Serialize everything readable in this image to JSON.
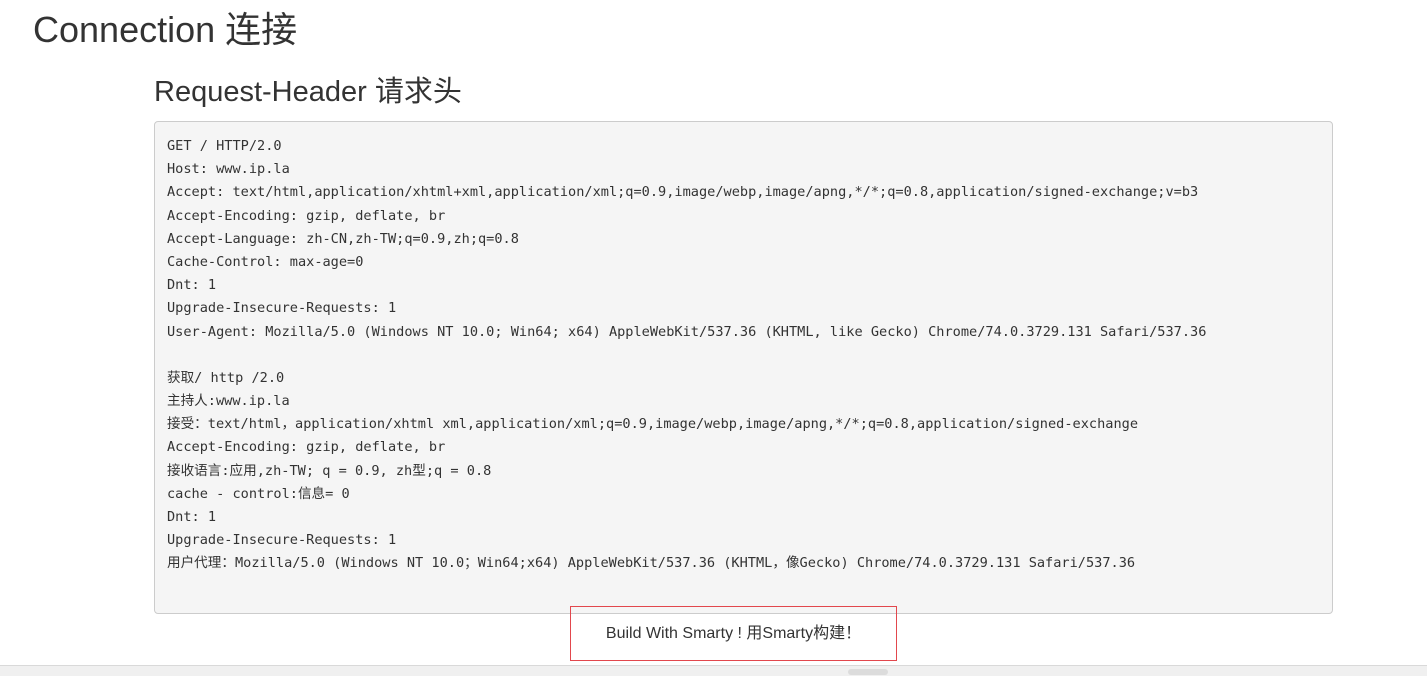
{
  "section_title": "Connection 连接",
  "subsection_title": "Request-Header 请求头",
  "request_headers": {
    "lines": [
      "GET / HTTP/2.0",
      "Host: www.ip.la",
      "Accept: text/html,application/xhtml+xml,application/xml;q=0.9,image/webp,image/apng,*/*;q=0.8,application/signed-exchange;v=b3",
      "Accept-Encoding: gzip, deflate, br",
      "Accept-Language: zh-CN,zh-TW;q=0.9,zh;q=0.8",
      "Cache-Control: max-age=0",
      "Dnt: 1",
      "Upgrade-Insecure-Requests: 1",
      "User-Agent: Mozilla/5.0 (Windows NT 10.0; Win64; x64) AppleWebKit/537.36 (KHTML, like Gecko) Chrome/74.0.3729.131 Safari/537.36",
      "",
      "获取/ http /2.0",
      "主持人:www.ip.la",
      "接受：text/html，application/xhtml xml,application/xml;q=0.9,image/webp,image/apng,*/*;q=0.8,application/signed-exchange",
      "Accept-Encoding: gzip, deflate, br",
      "接收语言:应用,zh-TW; q = 0.9, zh型;q = 0.8",
      "cache - control:信息= 0",
      "Dnt: 1",
      "Upgrade-Insecure-Requests: 1",
      "用户代理：Mozilla/5.0 (Windows NT 10.0；Win64;x64) AppleWebKit/537.36 (KHTML，像Gecko) Chrome/74.0.3729.131 Safari/537.36"
    ]
  },
  "footer": {
    "text": "Build With Smarty ! 用Smarty构建！"
  },
  "colors": {
    "footer_border": "#e2474d",
    "pre_background": "#f5f5f5",
    "pre_border": "#cccccc",
    "text": "#333333"
  }
}
